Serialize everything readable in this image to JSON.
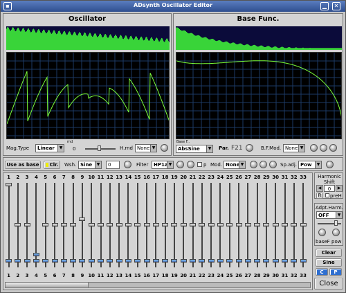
{
  "window": {
    "title": "ADsynth Oscillator Editor"
  },
  "oscillator": {
    "title": "Oscillator",
    "mag_type_label": "Mag.Type",
    "mag_type_value": "Linear",
    "rnd_label": "rnd",
    "rnd_value": "0",
    "hmod_label": "H.rnd",
    "hmod_value": "None"
  },
  "basefunc": {
    "title": "Base Func.",
    "small_label": "Base F..",
    "func_value": "AbsSine",
    "par_label": "Par.",
    "par_value": "F21",
    "bfmod_label": "B.F.Mod.",
    "bfmod_value": "None"
  },
  "toolbar": {
    "use_as_base": "Use as base",
    "clr": "Clr.",
    "wsh_label": "Wsh.",
    "wsh_value": "Sine",
    "wsh_number": "0",
    "filter_label": "Filter",
    "filter_value": "HP1a",
    "p_label": "p",
    "mod_label": "Mod.",
    "mod_value": "None",
    "spadj_label": "Sp.adj.",
    "spadj_value": "Pow"
  },
  "harmonics": {
    "numbers": [
      "1",
      "2",
      "3",
      "4",
      "5",
      "6",
      "7",
      "8",
      "9",
      "10",
      "11",
      "12",
      "13",
      "14",
      "15",
      "16",
      "17",
      "18",
      "19",
      "20",
      "21",
      "22",
      "23",
      "24",
      "25",
      "26",
      "27",
      "28",
      "29",
      "30",
      "31",
      "32",
      "33"
    ],
    "magnitude_levels": [
      1.0,
      0.5,
      0.5,
      0.13,
      0.5,
      0.5,
      0.5,
      0.5,
      0.57,
      0.5,
      0.5,
      0.5,
      0.5,
      0.5,
      0.5,
      0.5,
      0.5,
      0.5,
      0.5,
      0.5,
      0.5,
      0.5,
      0.5,
      0.5,
      0.5,
      0.5,
      0.5,
      0.5,
      0.5,
      0.5,
      0.5,
      0.5,
      0.5
    ]
  },
  "side": {
    "harmonic_shift_label": "Harmonic Shift",
    "shift_value": "0",
    "r_label": "R",
    "preh_label": "preH",
    "adpt_label": "Adpt.Harm.",
    "adpt_value": "OFF",
    "basef_label": "baseF",
    "pow_label": "pow",
    "clear_label": "Clear",
    "sine_label": "Sine",
    "c_label": "C",
    "p_label": "P",
    "close_label": "Close"
  },
  "colors": {
    "wave": "#7dff3a",
    "spectrum": "#39d439",
    "grid": "#1d3a66",
    "accent": "#2f4f8f"
  }
}
